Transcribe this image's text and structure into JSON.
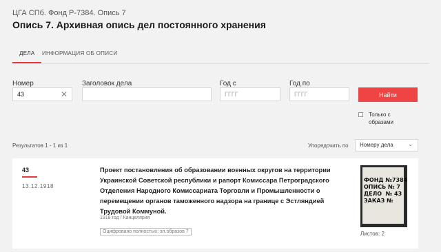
{
  "breadcrumb": "ЦГА СПб. Фонд Р-7384. Опись 7",
  "page_title": "Опись 7. Архивная опись дел постоянного хранения",
  "tabs": [
    {
      "label": "ДЕЛА"
    },
    {
      "label": "ИНФОРМАЦИЯ ОБ ОПИСИ"
    }
  ],
  "filters": {
    "number_label": "Номер",
    "number_value": "43",
    "title_label": "Заголовок дела",
    "title_value": "",
    "year_from_label": "Год с",
    "year_from_placeholder": "ГГГГ",
    "year_to_label": "Год по",
    "year_to_placeholder": "ГГГГ",
    "search_button": "Найти",
    "with_images_label": "Только с образами"
  },
  "results_summary": "Результатов 1 - 1 из 1",
  "sort": {
    "label": "Упорядочить по",
    "selected": "Номеру дела"
  },
  "records": [
    {
      "number": "43",
      "date": "13.12.1918",
      "title": "Проект постановления об образовании военных округов на территории Украинской Советской республики и рапорт Комиссара Петроградского Отделения Народного Комиссариата Торговли и Промышленности о перемещении органов таможенного надзора на границе с Эстляндией Трудовой Коммуной.",
      "meta": "1918 год / Канцелярия",
      "digitized": "Оцифровано полностью: эл.образов 7",
      "thumbnail_text": "ФОНД №7384\nОПИСЬ № 7\nДЕЛО  № 43\nЗАКАЗ №",
      "sheets": "Листов: 2"
    }
  ],
  "colors": {
    "accent": "#ee4444",
    "background": "#f2f2f2",
    "card": "#ffffff"
  }
}
